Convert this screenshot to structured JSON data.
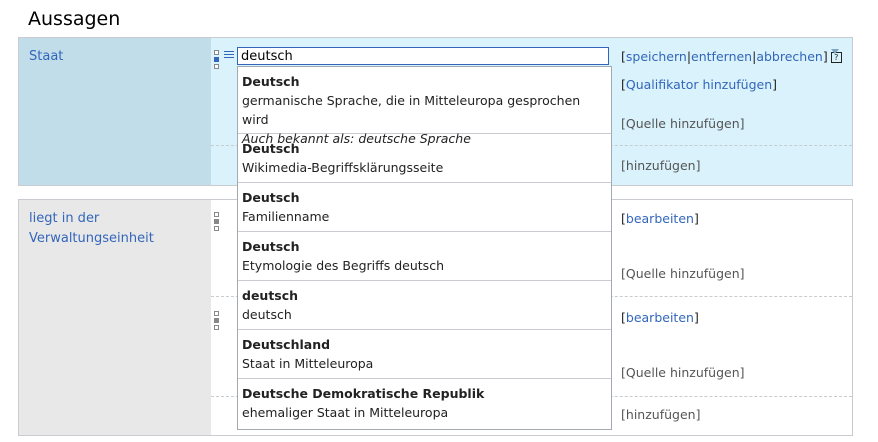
{
  "heading": "Aussagen",
  "statement1": {
    "property": "Staat",
    "input_value": "deutsch",
    "toolbar": {
      "open": "[",
      "save": "speichern",
      "sep": "|",
      "remove": "entfernen",
      "cancel": "abbrechen",
      "close": "]"
    },
    "add_qualifier": "Qualifikator hinzufügen",
    "add_source": "Quelle hinzufügen",
    "add": "hinzufügen"
  },
  "statement2": {
    "property": "liegt in der Verwaltungseinheit",
    "edit1": "bearbeiten",
    "source1": "Quelle hinzufügen",
    "edit2": "bearbeiten",
    "source2": "Quelle hinzufügen",
    "add": "hinzufügen"
  },
  "suggestions": [
    {
      "title": "Deutsch",
      "desc": "germanische Sprache, die in Mitteleuropa gesprochen wird",
      "alias": "Auch bekannt als: deutsche Sprache"
    },
    {
      "title": "Deutsch",
      "desc": "Wikimedia-Begriffsklärungsseite"
    },
    {
      "title": "Deutsch",
      "desc": "Familienname"
    },
    {
      "title": "Deutsch",
      "desc": "Etymologie des Begriffs deutsch"
    },
    {
      "title": "deutsch",
      "desc": "deutsch"
    },
    {
      "title": "Deutschland",
      "desc": "Staat in Mitteleuropa"
    },
    {
      "title": "Deutsche Demokratische Republik",
      "desc": "ehemaliger Staat in Mitteleuropa"
    }
  ],
  "icons": {
    "rank": "rank-selector-icon",
    "list": "list-icon",
    "help": "help-icon",
    "toggle": "chevron-down-icon"
  },
  "colors": {
    "link": "#3366bb",
    "editing_bg": "#d9f2fb",
    "property_editing_bg": "#c0dde9",
    "property_bg": "#e8e8e8"
  }
}
